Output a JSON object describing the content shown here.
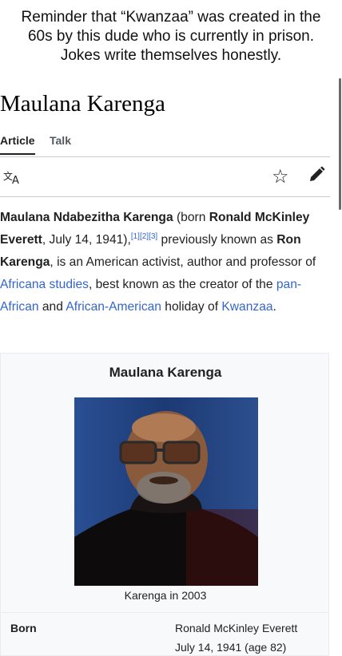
{
  "caption": {
    "line1": "Reminder that “Kwanzaa” was created in the",
    "line2": "60s by this dude who is currently in prison.",
    "line3": "Jokes write themselves honestly."
  },
  "page": {
    "title": "Maulana Karenga"
  },
  "tabs": [
    {
      "label": "Article",
      "active": true
    },
    {
      "label": "Talk",
      "active": false
    }
  ],
  "toolbar": {
    "language_icon": "translate-icon",
    "watch_icon": "star-icon",
    "edit_icon": "pencil-icon"
  },
  "lead": {
    "name_bold": "Maulana Ndabezitha Karenga",
    "born_prefix": " (born ",
    "born_name_bold": "Ronald McKinley Everett",
    "date_text": ", July 14, 1941),",
    "refs": "[1][2][3]",
    "previously": " previously known as ",
    "alias_bold": "Ron Karenga",
    "middle": ", is an American activist, author and professor of ",
    "link_africana": "Africana studies",
    "best_known": ", best known as the creator of the ",
    "link_pan_african": "pan-African",
    "and": " and ",
    "link_african_american": "African-American",
    "holiday": " holiday of ",
    "link_kwanzaa": "Kwanzaa",
    "end": "."
  },
  "infobox": {
    "title": "Maulana Karenga",
    "image_caption": "Karenga in 2003",
    "born_label": "Born",
    "born_name": "Ronald McKinley Everett",
    "born_date": "July 14, 1941 (age 82)"
  },
  "colors": {
    "link": "#3366cc",
    "text": "#202122",
    "border": "#c8ccd1",
    "infobox_bg": "#f8f9fa"
  }
}
